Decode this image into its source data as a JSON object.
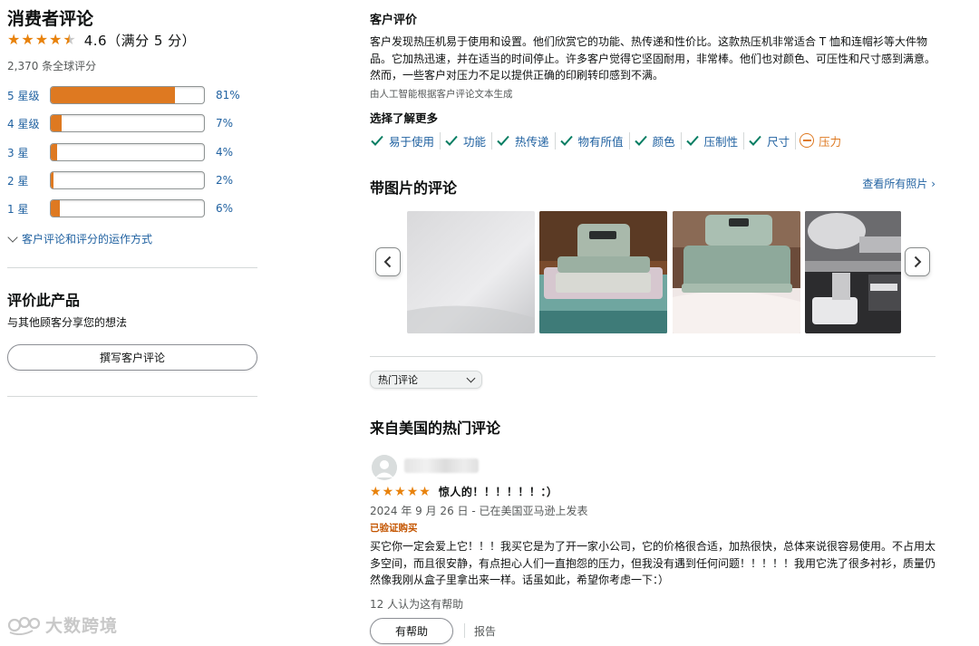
{
  "left": {
    "title": "消费者评论",
    "rating_value": 4.6,
    "rating_text": "4.6（满分 5 分）",
    "global_count": "2,370 条全球评分",
    "histogram": [
      {
        "label": "5 星级",
        "percent_text": "81%",
        "fraction": 0.81
      },
      {
        "label": "4 星级",
        "percent_text": "7%",
        "fraction": 0.07
      },
      {
        "label": "3 星",
        "percent_text": "4%",
        "fraction": 0.04
      },
      {
        "label": "2 星",
        "percent_text": "2%",
        "fraction": 0.02
      },
      {
        "label": "1 星",
        "percent_text": "6%",
        "fraction": 0.06
      }
    ],
    "how_link": "客户评论和评分的运作方式",
    "review_section_title": "评价此产品",
    "review_section_sub": "与其他顾客分享您的想法",
    "write_button": "撰写客户评论"
  },
  "watermark": "大数跨境",
  "right": {
    "customer_head": "客户评价",
    "summary": "客户发现热压机易于使用和设置。他们欣赏它的功能、热传递和性价比。这款热压机非常适合 T 恤和连帽衫等大件物品。它加热迅速，并在适当的时间停止。许多客户觉得它坚固耐用，非常棒。他们也对颜色、可压性和尺寸感到满意。然而，一些客户对压力不足以提供正确的印刷转印感到不满。",
    "ai_note": "由人工智能根据客户评论文本生成",
    "learn_more": "选择了解更多",
    "aspects": [
      {
        "label": "易于使用",
        "sentiment": "positive"
      },
      {
        "label": "功能",
        "sentiment": "positive"
      },
      {
        "label": "热传递",
        "sentiment": "positive"
      },
      {
        "label": "物有所值",
        "sentiment": "positive"
      },
      {
        "label": "颜色",
        "sentiment": "positive"
      },
      {
        "label": "压制性",
        "sentiment": "positive"
      },
      {
        "label": "尺寸",
        "sentiment": "positive"
      },
      {
        "label": "压力",
        "sentiment": "negative"
      }
    ],
    "photos_head": "带图片的评论",
    "photos_link": "查看所有照片 ›",
    "sort_value": "热门评论",
    "top_reviews_head": "来自美国的热门评论",
    "review": {
      "stars": 5,
      "title": "惊人的！！！！！！：）",
      "date": "2024 年 9 月 26 日 - 已在美国亚马逊上发表",
      "verified": "已验证购买",
      "body": "买它你一定会爱上它！！！我买它是为了开一家小公司，它的价格很合适，加热很快，总体来说很容易使用。不占用太多空间，而且很安静，有点担心人们一直抱怨的压力，但我没有遇到任何问题！！！！！我用它洗了很多衬衫，质量仍然像我刚从盒子里拿出来一样。话虽如此，希望你考虑一下：）",
      "helpful_count": "12 人认为这有帮助",
      "helpful_button": "有帮助",
      "report": "报告"
    }
  },
  "colors": {
    "link": "#2162a1",
    "star": "#e8820c",
    "bar_fill": "#de7921",
    "check": "#067d62",
    "verified": "#c45500"
  },
  "icons": [
    "star-icon",
    "chevron-down-icon",
    "check-icon",
    "minus-circle-icon",
    "chevron-left-icon",
    "chevron-right-icon",
    "avatar-icon",
    "watermark-logo"
  ]
}
